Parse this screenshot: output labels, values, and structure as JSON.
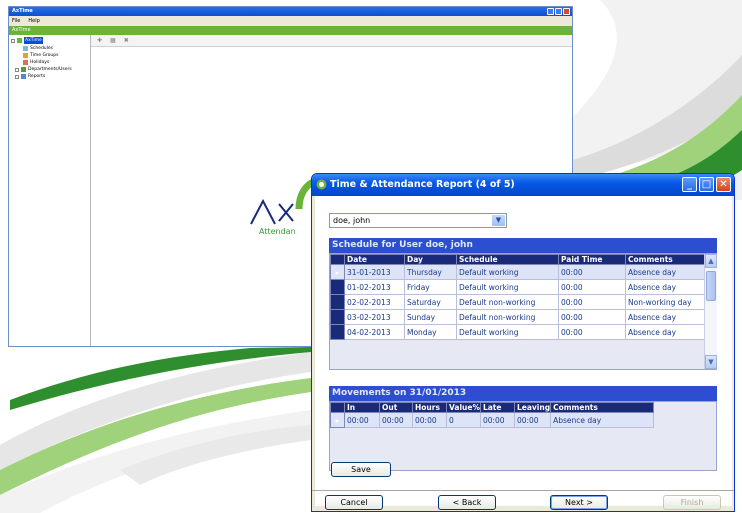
{
  "back_window": {
    "title": "AxTime",
    "menu": [
      "File",
      "Help"
    ],
    "app_bar": "AxTime",
    "tree": {
      "root": "AxTime",
      "items": [
        "Schedules",
        "Time Groups",
        "Holidays",
        "Departments/Users",
        "Reports"
      ]
    },
    "toolbar_icons": [
      "add-icon",
      "grid-icon",
      "delete-icon"
    ],
    "logo_text": "Attendan"
  },
  "dialog": {
    "title": "Time & Attendance Report (4 of 5)",
    "user_select": {
      "value": "doe, john"
    },
    "schedule": {
      "heading": "Schedule for User doe, john",
      "columns": [
        "Date",
        "Day",
        "Schedule",
        "Paid Time",
        "Comments"
      ],
      "rows": [
        [
          "31-01-2013",
          "Thursday",
          "Default working",
          "00:00",
          "Absence day"
        ],
        [
          "01-02-2013",
          "Friday",
          "Default working",
          "00:00",
          "Absence day"
        ],
        [
          "02-02-2013",
          "Saturday",
          "Default non-working",
          "00:00",
          "Non-working day"
        ],
        [
          "03-02-2013",
          "Sunday",
          "Default non-working",
          "00:00",
          "Absence day"
        ],
        [
          "04-02-2013",
          "Monday",
          "Default working",
          "00:00",
          "Absence day"
        ]
      ],
      "selected_row": 0
    },
    "movements": {
      "heading": "Movements on 31/01/2013",
      "columns": [
        "In",
        "Out",
        "Hours",
        "Value%",
        "Late",
        "Leaving",
        "Comments"
      ],
      "rows": [
        [
          "00:00",
          "00:00",
          "00:00",
          "0",
          "00:00",
          "00:00",
          "Absence day"
        ]
      ]
    },
    "buttons": {
      "save": "Save",
      "cancel": "Cancel",
      "back": "< Back",
      "next": "Next >",
      "finish": "Finish"
    }
  },
  "colors": {
    "titlebar": "#0758e8",
    "section_bar": "#2d4ed1",
    "grid_header": "#1a2a7a",
    "accent_green": "#6ab43a"
  }
}
